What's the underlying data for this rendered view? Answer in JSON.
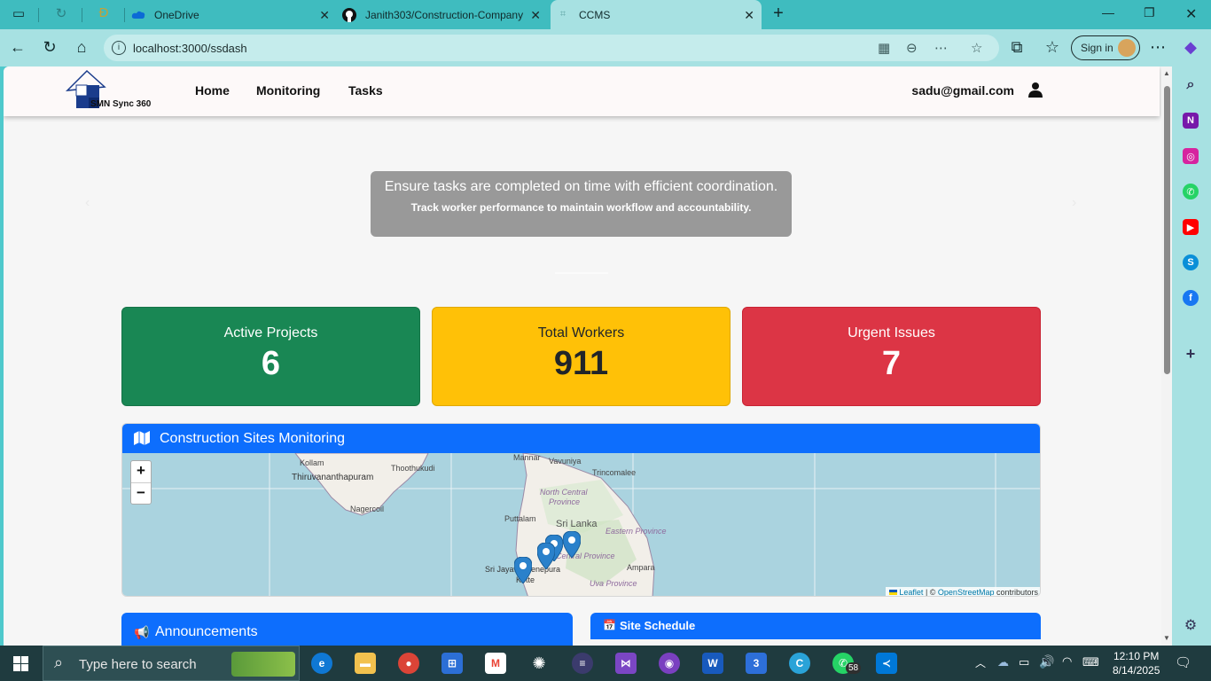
{
  "browser": {
    "tabs": [
      {
        "label": "OneDrive",
        "icon": "onedrive-icon"
      },
      {
        "label": "Janith303/Construction-Company",
        "icon": "github-icon"
      },
      {
        "label": "CCMS",
        "icon": "page-icon"
      }
    ],
    "url": "localhost:3000/ssdash",
    "sign_in_label": "Sign in"
  },
  "site": {
    "logo_text": "SMN Sync 360",
    "nav_items": [
      "Home",
      "Monitoring",
      "Tasks"
    ],
    "user_email": "sadu@gmail.com"
  },
  "carousel": {
    "heading": "Ensure tasks are completed on time with efficient coordination.",
    "subtext": "Track worker performance to maintain workflow and accountability."
  },
  "stats": [
    {
      "label": "Active Projects",
      "value": "6",
      "color": "#198754"
    },
    {
      "label": "Total Workers",
      "value": "911",
      "color": "#ffc107"
    },
    {
      "label": "Urgent Issues",
      "value": "7",
      "color": "#dc3545"
    }
  ],
  "map": {
    "title": "Construction Sites Monitoring",
    "zoom_in": "+",
    "zoom_out": "−",
    "place_labels": [
      "Kollam",
      "Thoothukudi",
      "Thiruvananthapuram",
      "Nagercoil",
      "Mannar",
      "Vavuniya",
      "Trincomalee",
      "North Central",
      "Province",
      "Puttalam",
      "Sri Lanka",
      "Eastern Province",
      "Central Province",
      "Sri Jayawardenepura",
      "Kotte",
      "Ampara",
      "Uva Province"
    ],
    "attribution": {
      "leaflet": "Leaflet",
      "sep": " | © ",
      "osm": "OpenStreetMap",
      "suffix": " contributors"
    },
    "marker_count": 4
  },
  "cards": {
    "announcements": "Announcements",
    "site_schedule": "Site Schedule"
  },
  "taskbar": {
    "search_placeholder": "Type here to search",
    "time": "12:10 PM",
    "date": "8/14/2025",
    "whatsapp_badge": "58"
  },
  "colors": {
    "primary": "#0d6efd",
    "tab_bar": "#3fbcbf",
    "address_bar": "#a7e1e2"
  }
}
